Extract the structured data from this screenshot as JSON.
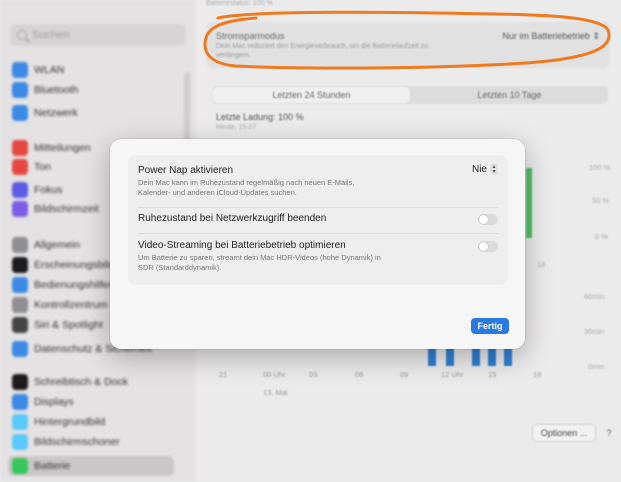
{
  "sidebar": {
    "search_placeholder": "Suchen",
    "items": [
      {
        "label": "WLAN",
        "icon": "wifi-icon",
        "color": "#3b8ae6"
      },
      {
        "label": "Bluetooth",
        "icon": "bluetooth-icon",
        "color": "#3b8ae6"
      },
      {
        "label": "Netzwerk",
        "icon": "globe-icon",
        "color": "#3b8ae6"
      },
      {
        "label": "Mitteilungen",
        "icon": "bell-icon",
        "color": "#e5483f"
      },
      {
        "label": "Ton",
        "icon": "speaker-icon",
        "color": "#e5483f"
      },
      {
        "label": "Fokus",
        "icon": "moon-icon",
        "color": "#5e5ce6"
      },
      {
        "label": "Bildschirmzeit",
        "icon": "hourglass-icon",
        "color": "#7b5ce6"
      },
      {
        "label": "Allgemein",
        "icon": "gear-icon",
        "color": "#8e8e93"
      },
      {
        "label": "Erscheinungsbild",
        "icon": "appearance-icon",
        "color": "#1c1c1e"
      },
      {
        "label": "Bedienungshilfen",
        "icon": "accessibility-icon",
        "color": "#3b8ae6"
      },
      {
        "label": "Kontrollzentrum",
        "icon": "control-center-icon",
        "color": "#8e8e93"
      },
      {
        "label": "Siri & Spotlight",
        "icon": "siri-icon",
        "color": "#444"
      },
      {
        "label": "Datenschutz & Sicherheit",
        "icon": "hand-icon",
        "color": "#3b8ae6"
      },
      {
        "label": "Schreibtisch & Dock",
        "icon": "dock-icon",
        "color": "#1c1c1e"
      },
      {
        "label": "Displays",
        "icon": "display-icon",
        "color": "#3b8ae6"
      },
      {
        "label": "Hintergrundbild",
        "icon": "wallpaper-icon",
        "color": "#5ac8fa"
      },
      {
        "label": "Bildschirmschoner",
        "icon": "screensaver-icon",
        "color": "#5ac8fa"
      },
      {
        "label": "Batterie",
        "icon": "battery-icon",
        "color": "#34c759"
      }
    ]
  },
  "main": {
    "top_strip": "Batteriestatus: 100 %",
    "energy_mode": {
      "title": "Stromsparmodus",
      "description": "Dein Mac reduziert den Energieverbrauch, um die Batterielaufzeit zu verlängern.",
      "value": "Nur im Batteriebetrieb"
    },
    "segments": [
      "Letzten 24 Stunden",
      "Letzten 10 Tage"
    ],
    "last_charge": "Letzte Ladung: 100 %",
    "last_charge_time": "Heute, 15:27",
    "right_labels": [
      "100 %",
      "50 %",
      "0 %",
      "60min",
      "30min",
      "0min"
    ],
    "x_labels": [
      "21",
      "00 Uhr",
      "03",
      "06",
      "09",
      "12 Uhr",
      "15",
      "18"
    ],
    "hidden_x_label": "18",
    "date_label": "13. Mai",
    "options_button": "Optionen ...",
    "help_button": "?"
  },
  "modal": {
    "power_nap": {
      "title": "Power Nap aktivieren",
      "description": "Dein Mac kann im Ruhezustand regelmäßig nach neuen E-Mails, Kalender- und anderen iCloud-Updates suchen.",
      "value": "Nie"
    },
    "wake_network": {
      "title": "Ruhezustand bei Netzwerkzugriff beenden",
      "enabled": false
    },
    "video_streaming": {
      "title": "Video-Streaming bei Batteriebetrieb optimieren",
      "description": "Um Batterie zu sparen, streamt dein Mac HDR-Videos (hohe Dynamik) in SDR (Standarddynamik).",
      "enabled": false
    },
    "done_button": "Fertig"
  },
  "colors": {
    "accent": "#2b7ae3",
    "annotation": "#f07a1f",
    "battery_green": "#56c16a"
  }
}
